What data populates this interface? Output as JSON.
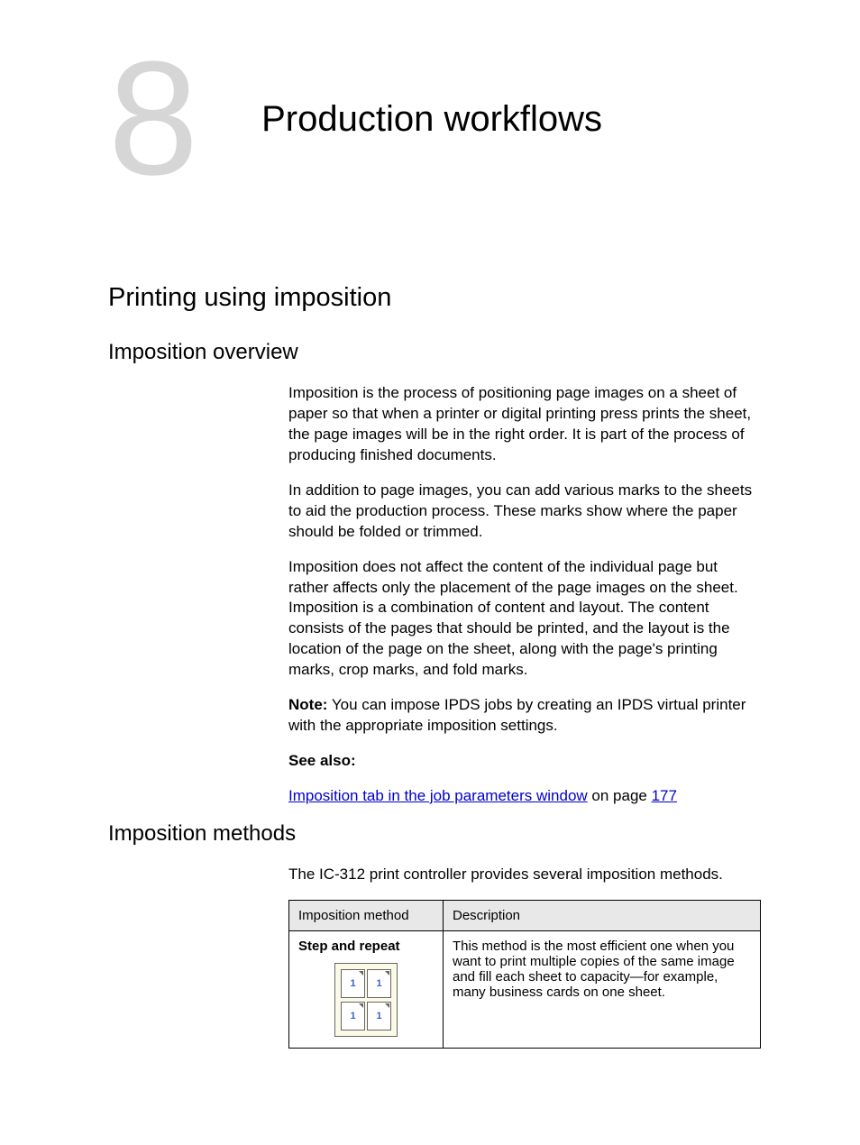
{
  "chapter": {
    "number": "8",
    "title": "Production workflows"
  },
  "section1": {
    "heading": "Printing using imposition",
    "sub1": {
      "heading": "Imposition overview",
      "p1": "Imposition is the process of positioning page images on a sheet of paper so that when a printer or digital printing press prints the sheet, the page images will be in the right order. It is part of the process of producing finished documents.",
      "p2": "In addition to page images, you can add various marks to the sheets to aid the production process. These marks show where the paper should be folded or trimmed.",
      "p3": "Imposition does not affect the content of the individual page but rather affects only the placement of the page images on the sheet. Imposition is a combination of content and layout. The content consists of the pages that should be printed, and the layout is the location of the page on the sheet, along with the page's printing marks, crop marks, and fold marks.",
      "note_label": "Note:",
      "note_text": " You can impose IPDS jobs by creating an IPDS virtual printer with the appropriate imposition settings.",
      "see_also_label": "See also:",
      "see_also_link": "Imposition tab in the job parameters window",
      "see_also_mid": " on page ",
      "see_also_page": "177"
    },
    "sub2": {
      "heading": "Imposition methods",
      "intro": "The IC-312 print controller provides several imposition methods.",
      "table": {
        "h1": "Imposition method",
        "h2": "Description",
        "row1": {
          "method": "Step and repeat",
          "desc": "This method is the most efficient one when you want to print multiple copies of the same image and fill each sheet to capacity—for example, many business cards on one sheet.",
          "cells": [
            "1",
            "1",
            "1",
            "1"
          ]
        }
      }
    }
  }
}
